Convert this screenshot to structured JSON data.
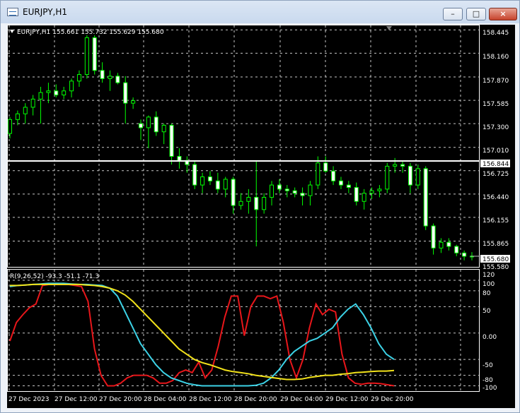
{
  "window": {
    "title": "EURJPY,H1",
    "minimize_label": "–",
    "maximize_label": "□",
    "close_label": "×"
  },
  "main_chart": {
    "info": "EURJPY,H1  155.661 155.732 155.629 155.680",
    "horizontal_line_price": "156.844",
    "current_price": "155.680",
    "price_labels": [
      "158.445",
      "158.160",
      "157.870",
      "157.585",
      "157.300",
      "157.010",
      "156.725",
      "156.440",
      "156.155",
      "155.865",
      "155.580"
    ]
  },
  "indicator": {
    "info": "R(9,26,52) -93.3 -51.1 -71.3",
    "scale_labels": [
      "120",
      "100",
      "80",
      "50",
      "0.00",
      "-50",
      "-80",
      "-100"
    ]
  },
  "time_labels": [
    "27 Dec 2023",
    "27 Dec 12:00",
    "27 Dec 20:00",
    "28 Dec 04:00",
    "28 Dec 12:00",
    "28 Dec 20:00",
    "29 Dec 04:00",
    "29 Dec 12:00",
    "29 Dec 20:00"
  ],
  "chart_data": {
    "type": "candlestick",
    "symbol": "EURJPY",
    "timeframe": "H1",
    "ylim": [
      155.55,
      158.5
    ],
    "horizontal_line": 156.844,
    "last_price": 155.68,
    "ohlc": [
      [
        157.18,
        157.38,
        157.12,
        157.35
      ],
      [
        157.35,
        157.46,
        157.28,
        157.42
      ],
      [
        157.42,
        157.55,
        157.3,
        157.5
      ],
      [
        157.5,
        157.65,
        157.4,
        157.6
      ],
      [
        157.6,
        157.75,
        157.3,
        157.68
      ],
      [
        157.68,
        157.8,
        157.55,
        157.7
      ],
      [
        157.7,
        157.78,
        157.62,
        157.65
      ],
      [
        157.65,
        157.75,
        157.6,
        157.7
      ],
      [
        157.7,
        157.85,
        157.62,
        157.82
      ],
      [
        157.82,
        157.95,
        157.75,
        157.9
      ],
      [
        157.9,
        158.38,
        157.85,
        158.35
      ],
      [
        158.35,
        158.38,
        157.9,
        157.95
      ],
      [
        157.95,
        158.05,
        157.8,
        157.85
      ],
      [
        157.85,
        157.95,
        157.7,
        157.88
      ],
      [
        157.88,
        157.92,
        157.78,
        157.8
      ],
      [
        157.8,
        157.88,
        157.3,
        157.55
      ],
      [
        157.55,
        157.62,
        157.48,
        157.58
      ],
      [
        157.3,
        157.35,
        157.1,
        157.25
      ],
      [
        157.25,
        157.4,
        157.0,
        157.38
      ],
      [
        157.38,
        157.45,
        157.15,
        157.2
      ],
      [
        157.2,
        157.3,
        157.05,
        157.28
      ],
      [
        157.28,
        157.3,
        156.8,
        156.9
      ],
      [
        156.9,
        157.0,
        156.75,
        156.85
      ],
      [
        156.85,
        156.9,
        156.7,
        156.8
      ],
      [
        156.8,
        156.85,
        156.5,
        156.55
      ],
      [
        156.55,
        156.7,
        156.45,
        156.65
      ],
      [
        156.65,
        156.72,
        156.55,
        156.6
      ],
      [
        156.6,
        156.7,
        156.45,
        156.5
      ],
      [
        156.5,
        156.65,
        156.4,
        156.62
      ],
      [
        156.62,
        156.65,
        156.2,
        156.3
      ],
      [
        156.3,
        156.45,
        156.25,
        156.35
      ],
      [
        156.35,
        156.5,
        156.2,
        156.4
      ],
      [
        156.4,
        156.85,
        155.8,
        156.25
      ],
      [
        156.25,
        156.45,
        156.2,
        156.4
      ],
      [
        156.4,
        156.6,
        156.3,
        156.55
      ],
      [
        156.55,
        156.62,
        156.45,
        156.5
      ],
      [
        156.5,
        156.55,
        156.4,
        156.48
      ],
      [
        156.48,
        156.52,
        156.4,
        156.45
      ],
      [
        156.45,
        156.52,
        156.3,
        156.42
      ],
      [
        156.42,
        156.6,
        156.3,
        156.55
      ],
      [
        156.55,
        156.9,
        156.5,
        156.82
      ],
      [
        156.82,
        156.9,
        156.7,
        156.72
      ],
      [
        156.72,
        156.78,
        156.55,
        156.6
      ],
      [
        156.6,
        156.65,
        156.5,
        156.55
      ],
      [
        156.55,
        156.6,
        156.45,
        156.52
      ],
      [
        156.52,
        156.58,
        156.3,
        156.35
      ],
      [
        156.35,
        156.5,
        156.25,
        156.45
      ],
      [
        156.45,
        156.52,
        156.38,
        156.48
      ],
      [
        156.48,
        156.55,
        156.4,
        156.5
      ],
      [
        156.5,
        156.82,
        156.45,
        156.78
      ],
      [
        156.78,
        156.88,
        156.7,
        156.8
      ],
      [
        156.8,
        156.85,
        156.7,
        156.78
      ],
      [
        156.78,
        156.82,
        156.45,
        156.55
      ],
      [
        156.55,
        156.8,
        156.5,
        156.75
      ],
      [
        156.75,
        156.78,
        156.0,
        156.05
      ],
      [
        156.05,
        156.08,
        155.7,
        155.78
      ],
      [
        155.78,
        155.9,
        155.72,
        155.85
      ],
      [
        155.85,
        155.9,
        155.75,
        155.8
      ],
      [
        155.8,
        155.82,
        155.68,
        155.72
      ],
      [
        155.72,
        155.75,
        155.63,
        155.68
      ],
      [
        155.68,
        155.73,
        155.63,
        155.68
      ]
    ],
    "indicator": {
      "name": "R(9,26,52)",
      "ylim": [
        -110,
        120
      ],
      "values": [
        -93.3,
        -51.1,
        -71.3
      ],
      "series": [
        {
          "name": "R(9)",
          "color": "#e8161a",
          "values": [
            -15,
            20,
            35,
            48,
            55,
            90,
            92,
            92,
            92,
            92,
            90,
            88,
            60,
            -30,
            -80,
            -100,
            -100,
            -95,
            -85,
            -80,
            -80,
            -80,
            -85,
            -95,
            -95,
            -90,
            -75,
            -70,
            -75,
            -55,
            -85,
            -70,
            -25,
            30,
            70,
            70,
            -5,
            50,
            70,
            70,
            65,
            70,
            20,
            -50,
            -85,
            -50,
            10,
            55,
            35,
            45,
            40,
            -40,
            -85,
            -95,
            -97,
            -95,
            -95,
            -96,
            -98,
            -100
          ]
        },
        {
          "name": "R(26)",
          "color": "#3cd2e6",
          "values": [
            88,
            90,
            91,
            92,
            93,
            94,
            94,
            94,
            93,
            92,
            92,
            91,
            90,
            85,
            70,
            40,
            10,
            -20,
            -40,
            -60,
            -75,
            -85,
            -90,
            -95,
            -98,
            -100,
            -100,
            -100,
            -100,
            -100,
            -100,
            -100,
            -99,
            -95,
            -85,
            -70,
            -50,
            -35,
            -25,
            -15,
            -10,
            0,
            10,
            30,
            45,
            55,
            35,
            10,
            -20,
            -40,
            -50
          ]
        },
        {
          "name": "R(52)",
          "color": "#f2e21a",
          "values": [
            90,
            90,
            91,
            92,
            92,
            92,
            92,
            92,
            92,
            92,
            91,
            90,
            88,
            85,
            80,
            72,
            60,
            45,
            30,
            15,
            0,
            -15,
            -30,
            -40,
            -50,
            -56,
            -60,
            -65,
            -70,
            -73,
            -75,
            -77,
            -80,
            -82,
            -84,
            -86,
            -88,
            -88,
            -87,
            -84,
            -82,
            -80,
            -80,
            -78,
            -77,
            -75,
            -74,
            -73,
            -72,
            -72,
            -71
          ]
        }
      ]
    }
  }
}
